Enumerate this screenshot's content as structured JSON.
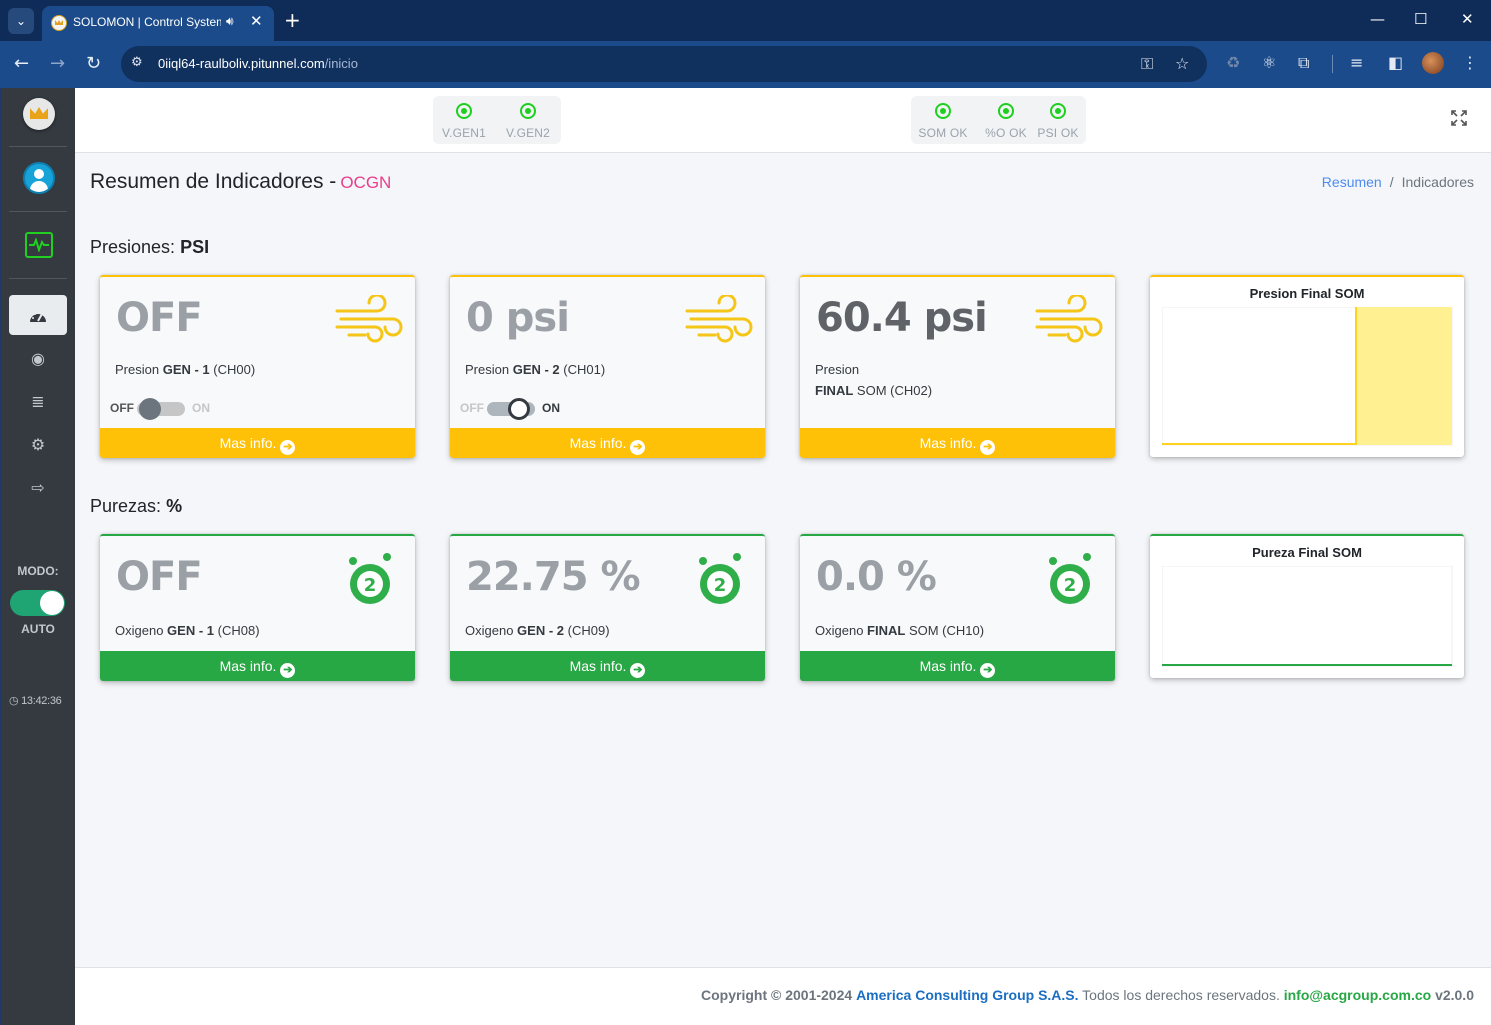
{
  "browser": {
    "tab_title": "SOLOMON | Control System",
    "url_host": "0iiql64-raulboliv.pitunnel.com",
    "url_path": "/inicio"
  },
  "topbar": {
    "indicators_left": [
      {
        "label": "V.GEN1",
        "status_color": "#1ed01e"
      },
      {
        "label": "V.GEN2",
        "status_color": "#1ed01e"
      }
    ],
    "indicators_right": [
      {
        "label": "SOM OK",
        "status_color": "#1ed01e"
      },
      {
        "label": "%O OK",
        "status_color": "#1ed01e"
      },
      {
        "label": "PSI OK",
        "status_color": "#1ed01e"
      }
    ]
  },
  "sidebar": {
    "modo_label": "MODO:",
    "mode_value": "AUTO",
    "clock": "13:42:36"
  },
  "header": {
    "title": "Resumen de Indicadores -",
    "subtitle": "OCGN",
    "breadcrumb": {
      "link": "Resumen",
      "sep": "/",
      "current": "Indicadores"
    }
  },
  "presiones": {
    "title_prefix": "Presiones:",
    "title_unit": "PSI",
    "cards": [
      {
        "value": "OFF",
        "label_prefix": "Presion",
        "label_bold": "GEN - 1",
        "label_suffix": "(CH00)",
        "toggle_off": "OFF",
        "toggle_on": "ON",
        "toggle_state": false,
        "footer": "Mas info."
      },
      {
        "value": "0 psi",
        "label_prefix": "Presion",
        "label_bold": "GEN - 2",
        "label_suffix": "(CH01)",
        "toggle_off": "OFF",
        "toggle_on": "ON",
        "toggle_state": true,
        "footer": "Mas info."
      },
      {
        "value": "60.4 psi",
        "label_prefix": "Presion",
        "label_bold": "FINAL",
        "label_suffix": "SOM (CH02)",
        "footer": "Mas info."
      }
    ],
    "chart_title": "Presion Final SOM"
  },
  "purezas": {
    "title_prefix": "Purezas:",
    "title_unit": "%",
    "cards": [
      {
        "value": "OFF",
        "label_prefix": "Oxigeno",
        "label_bold": "GEN - 1",
        "label_suffix": "(CH08)",
        "footer": "Mas info."
      },
      {
        "value": "22.75 %",
        "label_prefix": "Oxigeno",
        "label_bold": "GEN - 2",
        "label_suffix": "(CH09)",
        "footer": "Mas info."
      },
      {
        "value": "0.0 %",
        "label_prefix": "Oxigeno",
        "label_bold": "FINAL",
        "label_suffix": "SOM (CH10)",
        "footer": "Mas info."
      }
    ],
    "chart_title": "Pureza Final SOM"
  },
  "colors": {
    "warning": "#ffc107",
    "success": "#28a745",
    "accent": "#e83e8c",
    "link": "#4d8cf0"
  },
  "footer": {
    "copyright": "Copyright © 2001-2024",
    "company": "America Consulting Group S.A.S.",
    "rights": "Todos los derechos reservados.",
    "email": "info@acgroup.com.co",
    "version": "v2.0.0"
  }
}
